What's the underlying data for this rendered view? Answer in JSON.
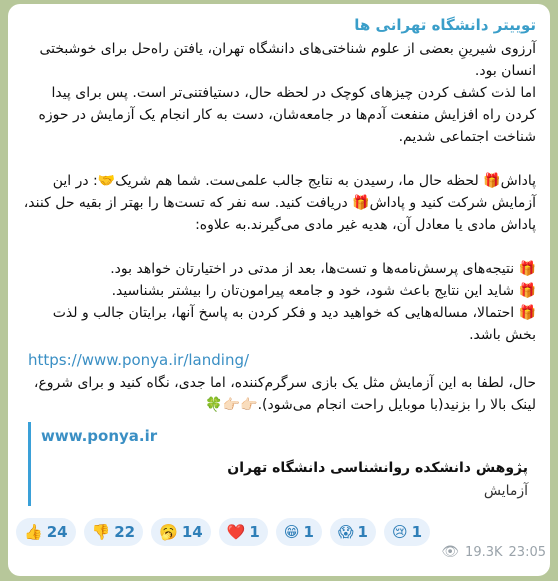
{
  "channel": {
    "name": "توییتر دانشگاه تهرانی ها"
  },
  "message": {
    "paragraphs": [
      "آرزوی شیرینِ بعضی از علوم شناختی‌های دانشگاه تهران، یافتن راه‌حل برای خوشبختی انسان بود.",
      "اما لذت کشف کردن چیزهای کوچک در لحظه حال، دستیافتنی‌تر است. پس برای پیدا کردن راه افزایش منفعت آدم‌ها در جامعه‌شان، دست به کار انجام یک آزمایش در حوزه شناخت اجتماعی شدیم."
    ],
    "reward_line": "پاداش🎁 لحظه حال ما، رسیدن به نتایج جالب علمی‌ست. شما هم شریک🤝: در این آزمایش شرکت کنید و پاداش🎁 دریافت کنید. سه نفر که تست‌ها را بهتر از بقیه حل کنند، پاداش مادی یا معادل آن، هدیه غیر مادی می‌گیرند.به علاوه:",
    "bullets": [
      "🎁 نتیجه‌های پرسش‌نامه‌ها و تست‌ها، بعد از مدتی در اختیارتان خواهد بود.",
      "🎁 شاید این نتایج باعث شود، خود و جامعه پیرامون‌تان را بیشتر بشناسید.",
      "🎁 احتمالا، مساله‌هایی که خواهید دید و فکر کردن به پاسخ آنها، برایتان جالب و لذت بخش باشد."
    ],
    "link": "https://www.ponya.ir/landing/",
    "closing": "حال، لطفا به این آزمایش مثل یک بازی سرگرم‌کننده، اما جدی، نگاه کنید و برای شروع، لینک بالا را بزنید(با موبایل راحت انجام می‌شود).👉🏻👉🏻🍀"
  },
  "preview": {
    "site": "www.ponya.ir",
    "title": "پژوهش دانشکده روانشناسی دانشگاه تهران",
    "description": "آزمایش"
  },
  "reactions": [
    {
      "emoji": "👍",
      "count": "24",
      "name": "thumbs-up"
    },
    {
      "emoji": "👎",
      "count": "22",
      "name": "thumbs-down"
    },
    {
      "emoji": "🥱",
      "count": "14",
      "name": "yawning-face"
    },
    {
      "emoji": "❤️",
      "count": "1",
      "name": "red-heart"
    },
    {
      "emoji": "😁",
      "count": "1",
      "name": "grinning-face"
    },
    {
      "emoji": "😱",
      "count": "1",
      "name": "screaming-face"
    },
    {
      "emoji": "😢",
      "count": "1",
      "name": "crying-face"
    }
  ],
  "meta": {
    "views": "19.3K",
    "time": "23:05",
    "eye_icon": "eye-icon"
  }
}
